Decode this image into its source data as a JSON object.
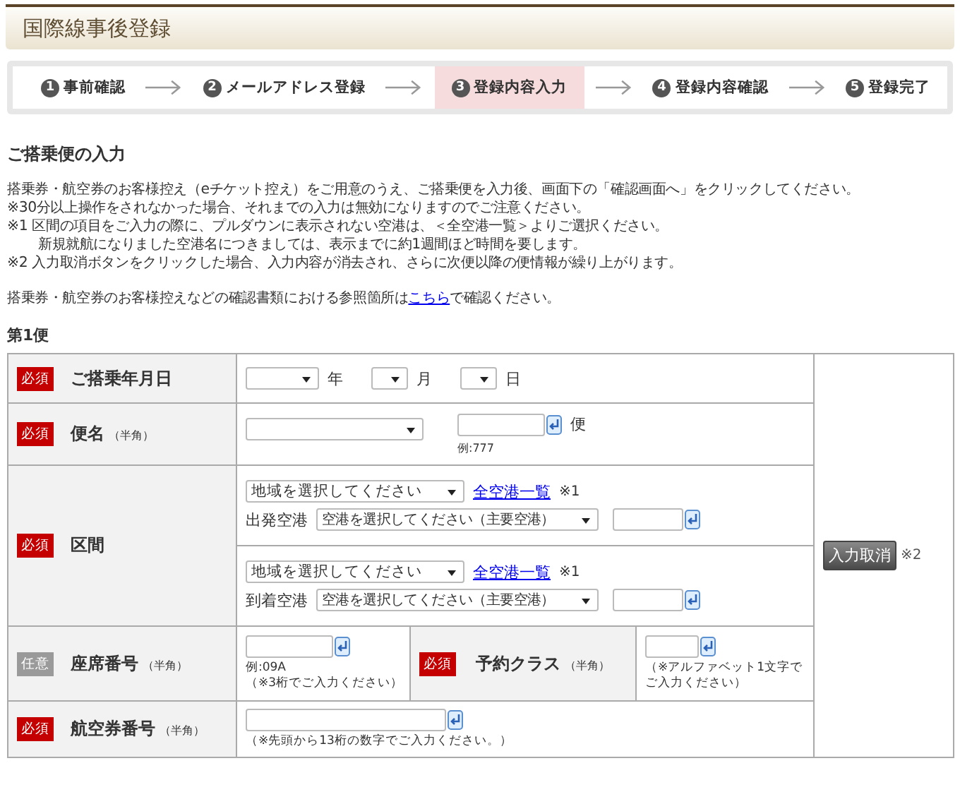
{
  "header": {
    "title": "国際線事後登録"
  },
  "steps": [
    {
      "number": "1",
      "label": "事前確認",
      "selected": false
    },
    {
      "number": "2",
      "label": "メールアドレス登録",
      "selected": false
    },
    {
      "number": "3",
      "label": "登録内容入力",
      "selected": true
    },
    {
      "number": "4",
      "label": "登録内容確認",
      "selected": false
    },
    {
      "number": "5",
      "label": "登録完了",
      "selected": false
    }
  ],
  "section_title": "ご搭乗便の入力",
  "instructions": [
    {
      "kind": "line",
      "text": "搭乗券・航空券のお客様控え（eチケット控え）をご用意のうえ、ご搭乗便を入力後、画面下の「確認画面へ」をクリックしてください。"
    },
    {
      "kind": "line",
      "text": "※30分以上操作をされなかった場合、それまでの入力は無効になりますのでご注意ください。"
    },
    {
      "kind": "line",
      "text": "※1 区間の項目をご入力の際に、プルダウンに表示されない空港は、＜全空港一覧＞よりご選択ください。"
    },
    {
      "kind": "continuation",
      "text": "新規就航になりました空港名につきましては、表示までに約1週間ほど時間を要します。"
    },
    {
      "kind": "line",
      "text": "※2 入力取消ボタンをクリックした場合、入力内容が消去され、さらに次便以降の便情報が繰り上がります。"
    }
  ],
  "reference_note": {
    "before": "搭乗券・航空券のお客様控えなどの確認書類における参照箇所は",
    "link": "こちら",
    "after": "で確認ください。"
  },
  "flight_heading": "第1便",
  "form": {
    "date": {
      "badge": "必須",
      "required": true,
      "label": "ご搭乗年月日",
      "units": [
        "年",
        "月",
        "日"
      ]
    },
    "flight": {
      "badge": "必須",
      "required": true,
      "label": "便名",
      "note": "（半角）",
      "unit": "便",
      "example": "例:777"
    },
    "route": {
      "badge": "必須",
      "required": true,
      "label": "区間",
      "legs": [
        {
          "region": "地域を選択してください",
          "link": "全空港一覧",
          "link_note": "※1",
          "airport_label": "出発空港",
          "airport": "空港を選択してください（主要空港）"
        },
        {
          "region": "地域を選択してください",
          "link": "全空港一覧",
          "link_note": "※1",
          "airport_label": "到着空港",
          "airport": "空港を選択してください（主要空港）"
        }
      ]
    },
    "seat": {
      "badge": "任意",
      "required": false,
      "label": "座席番号",
      "note": "（半角）",
      "hints": [
        "例:09A",
        "（※3桁でご入力ください）"
      ]
    },
    "booking_class": {
      "badge": "必須",
      "required": true,
      "label": "予約クラス",
      "note": "（半角）",
      "hints": [
        "（※アルファベット1文字で",
        "ご入力ください）"
      ]
    },
    "ticket": {
      "badge": "必須",
      "required": true,
      "label": "航空券番号",
      "note": "（半角）",
      "hints": [
        "（※先頭から13桁の数字でご入力ください。）"
      ]
    },
    "cancel": {
      "label": "入力取消",
      "note": "※2"
    }
  }
}
